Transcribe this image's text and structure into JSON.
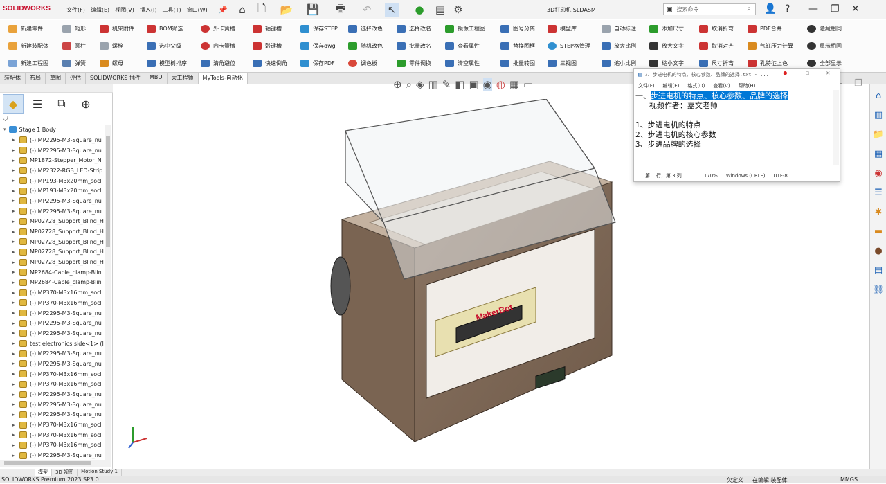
{
  "app": {
    "brand": "SOLIDWORKS",
    "window_title": "3D打印机.SLDASM"
  },
  "menu": [
    "文件(F)",
    "编辑(E)",
    "视图(V)",
    "插入(I)",
    "工具(T)",
    "窗口(W)"
  ],
  "search": {
    "placeholder": "搜索命令"
  },
  "commands": [
    [
      "新建零件",
      "新建装配体",
      "新建工程图"
    ],
    [
      "矩形",
      "圆柱",
      "弹簧"
    ],
    [
      "机架附件",
      "螺栓",
      "螺母"
    ],
    [
      "BOM筛选",
      "选中父级",
      "模型树排序"
    ],
    [
      "外卡簧槽",
      "内卡簧槽",
      "清角避位"
    ],
    [
      "轴键槽",
      "毂键槽",
      "快速倒角"
    ],
    [
      "保存STEP",
      "保存dwg",
      "保存PDF"
    ],
    [
      "选择改色",
      "随机改色",
      "调色板"
    ],
    [
      "选择改名",
      "批量改名",
      "零件调换"
    ],
    [
      "镜像工程图",
      "查看属性",
      "清空属性"
    ],
    [
      "图号分离",
      "替换图框",
      "批量转图"
    ],
    [
      "模型库",
      "STEP格管理",
      "三视图"
    ],
    [
      "自动标注",
      "放大比例",
      "缩小比例"
    ],
    [
      "添加尺寸",
      "放大文字",
      "缩小文字"
    ],
    [
      "取消折弯",
      "取消对齐",
      "尺寸折弯"
    ],
    [
      "PDF合并",
      "气缸压力计算",
      "孔特征上色"
    ],
    [
      "隐藏相同",
      "显示相同",
      "全部显示"
    ]
  ],
  "tabs": [
    "装配体",
    "布局",
    "草图",
    "评估",
    "SOLIDWORKS 插件",
    "MBD",
    "大工程师",
    "MyTools-自动化"
  ],
  "tree": {
    "root": "Stage 1 Body",
    "items": [
      "(-) MP2295-M3-Square_nu",
      "(-) MP2295-M3-Square_nu",
      "MP1872-Stepper_Motor_N",
      "(-) MP2322-RGB_LED-Strip",
      "(-) MP193-M3x20mm_socl",
      "(-) MP193-M3x20mm_socl",
      "(-) MP2295-M3-Square_nu",
      "(-) MP2295-M3-Square_nu",
      "MP02728_Support_Blind_H",
      "MP02728_Support_Blind_H",
      "MP02728_Support_Blind_H",
      "MP02728_Support_Blind_H",
      "MP02728_Support_Blind_H",
      "MP2684-Cable_clamp-Blin",
      "MP2684-Cable_clamp-Blin",
      "(-) MP370-M3x16mm_socl",
      "(-) MP370-M3x16mm_socl",
      "(-) MP2295-M3-Square_nu",
      "(-) MP2295-M3-Square_nu",
      "(-) MP2295-M3-Square_nu",
      "test electronics side<1> (I",
      "(-) MP2295-M3-Square_nu",
      "(-) MP2295-M3-Square_nu",
      "(-) MP370-M3x16mm_socl",
      "(-) MP370-M3x16mm_socl",
      "(-) MP2295-M3-Square_nu",
      "(-) MP2295-M3-Square_nu",
      "(-) MP2295-M3-Square_nu",
      "(-) MP370-M3x16mm_socl",
      "(-) MP370-M3x16mm_socl",
      "(-) MP370-M3x16mm_socl",
      "(-) MP2295-M3-Square_nu"
    ]
  },
  "notepad": {
    "title": "7、步进电机的特点、核心参数、品牌的选择.txt - ...",
    "menu": [
      "文件(F)",
      "编辑(E)",
      "格式(O)",
      "查看(V)",
      "帮助(H)"
    ],
    "line1_prefix": "一、",
    "line1_highlight": "步进电机的特点、核心参数、品牌的选择",
    "line2": "   视频作者：嘉文老师",
    "line3": "1、步进电机的特点",
    "line4": "2、步进电机的核心参数",
    "line5": "3、步进品牌的选择",
    "status_pos": "第 1 行，第 3 列",
    "status_zoom": "170%",
    "status_eol": "Windows (CRLF)",
    "status_enc": "UTF-8"
  },
  "bottom_tabs": [
    "模型",
    "3D 视图",
    "Motion Study 1"
  ],
  "status": {
    "left": "SOLIDWORKS Premium 2023 SP3.0",
    "undefined": "欠定义",
    "editing": "在编辑 装配体",
    "units": "MMGS"
  },
  "model_brand": "MakerBot"
}
